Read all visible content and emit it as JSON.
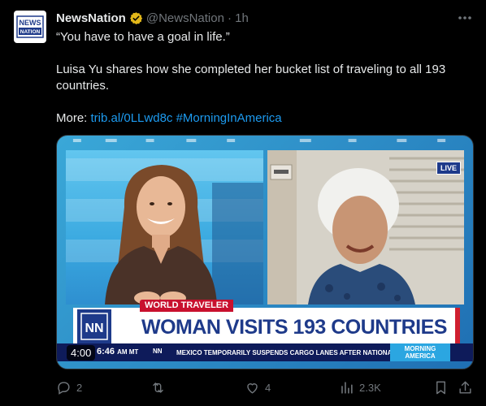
{
  "post": {
    "author_name": "NewsNation",
    "author_handle": "@NewsNation",
    "time_ago": "· 1h",
    "avatar_text_top": "NEWS",
    "avatar_text_bottom": "NATION",
    "text_line1": "“You have to have a goal in life.”",
    "text_line2": "Luisa Yu shares how she completed her bucket list of traveling to all 193 countries.",
    "more_label": "More:",
    "link_url": "trib.al/0LLwd8c",
    "hashtag": "#MorningInAmerica"
  },
  "video": {
    "live_label": "LIVE",
    "tag": "WORLD TRAVELER",
    "headline": "WOMAN VISITS 193 COUNTRIES",
    "clock": "6:46",
    "clock_suffix": "AM MT",
    "ticker_tag": "NN",
    "ticker_text": "MEXICO TEMPORARILY SUSPENDS CARGO LANES AFTER NATIONAL",
    "show_line1": "MORNING",
    "show_line2": "AMERICA",
    "duration": "4:00"
  },
  "actions": {
    "replies": "2",
    "reposts": "",
    "likes": "4",
    "views": "2.3K"
  },
  "colors": {
    "accent": "#1d9bf0",
    "verified": "#e2b719",
    "brand_blue": "#1e3a8a",
    "brand_red": "#c8102e"
  }
}
